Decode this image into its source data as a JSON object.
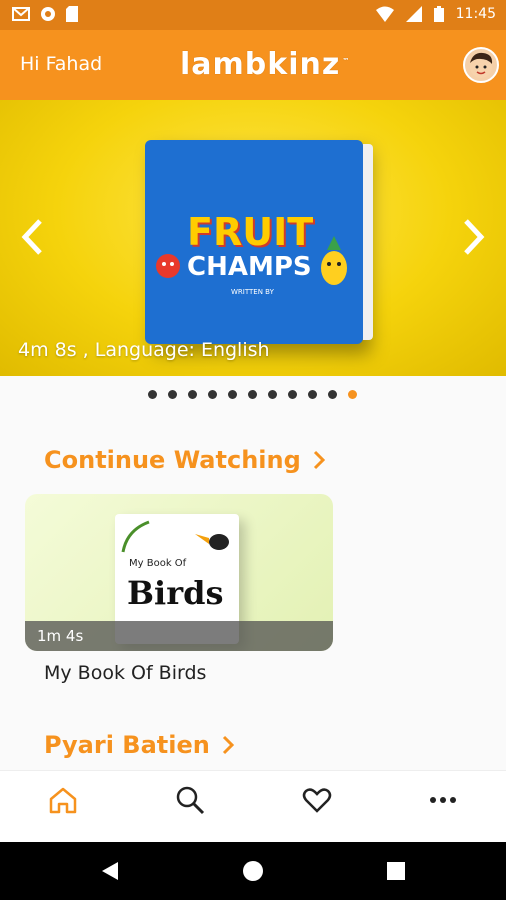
{
  "status_bar": {
    "time": "11:45",
    "left_icons": [
      "gmail-icon",
      "sync-icon",
      "sd-card-icon"
    ],
    "right_icons": [
      "wifi-icon",
      "signal-icon",
      "battery-icon"
    ]
  },
  "app_bar": {
    "greeting": "Hi Fahad",
    "logo_text": "lambkinz",
    "logo_mark": "™"
  },
  "banner": {
    "book_title_line1": "FRUIT",
    "book_title_line2": "CHAMPS",
    "book_author": "WRITTEN BY",
    "caption": "4m 8s , Language: English",
    "prev_icon": "chevron-left-icon",
    "next_icon": "chevron-right-icon",
    "dots_count": 11,
    "active_dot_index": 10
  },
  "continue_watching": {
    "title": "Continue Watching",
    "items": [
      {
        "book_subtitle": "My Book Of",
        "book_word": "Birds",
        "duration": "1m 4s",
        "title": "My Book Of Birds"
      }
    ]
  },
  "second_section": {
    "title": "Pyari Batien"
  },
  "bottom_nav": {
    "items": [
      {
        "name": "home",
        "icon": "home-icon",
        "active": true
      },
      {
        "name": "search",
        "icon": "search-icon",
        "active": false
      },
      {
        "name": "favorites",
        "icon": "heart-icon",
        "active": false
      },
      {
        "name": "more",
        "icon": "more-icon",
        "active": false
      }
    ]
  },
  "colors": {
    "accent": "#f6921e",
    "status_bar": "#e07f17"
  }
}
